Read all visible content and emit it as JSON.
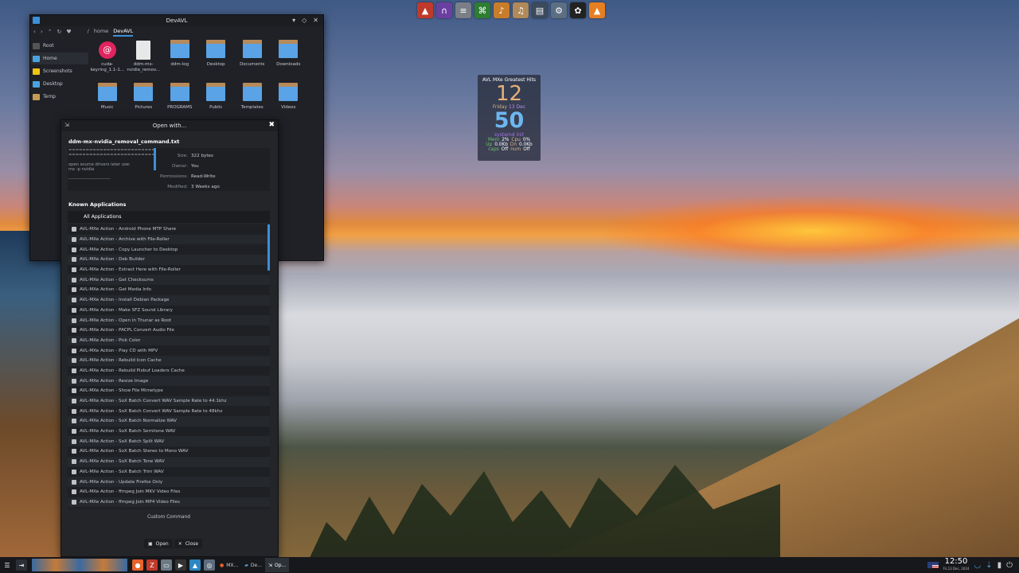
{
  "file_manager": {
    "title": "DevAVL",
    "breadcrumb": [
      "/",
      "home",
      "DevAVL"
    ],
    "sidebar": [
      {
        "label": "Root",
        "icon": "drive-icon"
      },
      {
        "label": "Home",
        "icon": "home-folder-icon"
      },
      {
        "label": "Screenshots",
        "icon": "star-icon"
      },
      {
        "label": "Desktop",
        "icon": "desktop-folder-icon"
      },
      {
        "label": "Temp",
        "icon": "folder-icon"
      }
    ],
    "files": [
      {
        "name": "cuda-keyring_1.1-1...",
        "type": "debian-package"
      },
      {
        "name": "ddm-mx-nvidia_remov...",
        "type": "text-file"
      },
      {
        "name": "ddm-log",
        "type": "folder"
      },
      {
        "name": "Desktop",
        "type": "folder"
      },
      {
        "name": "Documents",
        "type": "folder"
      },
      {
        "name": "Downloads",
        "type": "folder"
      },
      {
        "name": "Music",
        "type": "folder"
      },
      {
        "name": "Pictures",
        "type": "folder"
      },
      {
        "name": "PROGRAMS",
        "type": "folder"
      },
      {
        "name": "Public",
        "type": "folder"
      },
      {
        "name": "Templates",
        "type": "folder"
      },
      {
        "name": "Videos",
        "type": "folder"
      }
    ]
  },
  "open_with": {
    "title": "Open with...",
    "file_name": "ddm-mx-nvidia_removal_command.txt",
    "preview": [
      "============================",
      "============================",
      "",
      "open source drivers later use:",
      "mx -p nvidia",
      "",
      "----------------------------"
    ],
    "props": [
      {
        "k": "Size:",
        "v": "322 bytes"
      },
      {
        "k": "Owner:",
        "v": "You"
      },
      {
        "k": "Permissions:",
        "v": "Read-Write"
      },
      {
        "k": "Modified:",
        "v": "3 Weeks ago"
      }
    ],
    "known_label": "Known Applications",
    "all_apps_label": "All Applications",
    "apps": [
      "AVL-MXe Action - Android Phone MTP Share",
      "AVL-MXe Action - Archive with File-Roller",
      "AVL-MXe Action - Copy Launcher to Desktop",
      "AVL-MXe Action - Deb Builder",
      "AVL-MXe Action - Extract Here with File-Roller",
      "AVL-MXe Action - Get Checksums",
      "AVL-MXe Action - Get Media Info",
      "AVL-MXe Action - Install Debian Package",
      "AVL-MXe Action - Make SFZ Sound Library",
      "AVL-MXe Action - Open in Thunar as Root",
      "AVL-MXe Action - PACPL Convert Audio File",
      "AVL-MXe Action - Pick Color",
      "AVL-MXe Action - Play CD with MPV",
      "AVL-MXe Action - Rebuild Icon Cache",
      "AVL-MXe Action - Rebuild Pixbuf Loaders Cache",
      "AVL-MXe Action - Resize Image",
      "AVL-MXe Action - Show File Mimetype",
      "AVL-MXe Action - SoX Batch Convert WAV Sample Rate to 44.1khz",
      "AVL-MXe Action - SoX Batch Convert WAV Sample Rate to 48khz",
      "AVL-MXe Action - SoX Batch Normalize WAV",
      "AVL-MXe Action - SoX Batch Semitone WAV",
      "AVL-MXe Action - SoX Batch Split WAV",
      "AVL-MXe Action - SoX Batch Stereo to Mono WAV",
      "AVL-MXe Action - SoX Batch Tone WAV",
      "AVL-MXe Action - SoX Batch Trim WAV",
      "AVL-MXe Action - Update Firefox Only",
      "AVL-MXe Action - ffmpeg Join MKV Video Files",
      "AVL-MXe Action - ffmpeg Join MP4 Video Files"
    ],
    "custom_command": "Custom Command",
    "open_label": "Open",
    "close_label": "Close"
  },
  "conky": {
    "title": "AVL MXe Greatest Hits",
    "hour": "12",
    "day": "Friday",
    "date": "13 Dec",
    "minute": "50",
    "init": "systemd init",
    "mem_label": "Mem",
    "mem": "2%",
    "cpu_label": "Cpu",
    "cpu": "0%",
    "up_label": "Up",
    "up": "0.0Kb",
    "dn_label": "Dn",
    "dn": "0.0Kb",
    "caps_label": "caps",
    "caps": "Off",
    "num_label": "num",
    "num": "Off"
  },
  "taskbar": {
    "tasks": [
      {
        "label": "MX...",
        "icon": "firefox-icon"
      },
      {
        "label": "De...",
        "icon": "folder-icon"
      },
      {
        "label": "Op...",
        "icon": "open-with-icon"
      }
    ],
    "clock": "12:50",
    "date": "Fri,13 Dec, 2024"
  },
  "colors": {
    "accent": "#3d8fd6",
    "conky_hour": "#e7b07a",
    "conky_minute": "#6db7f0"
  }
}
